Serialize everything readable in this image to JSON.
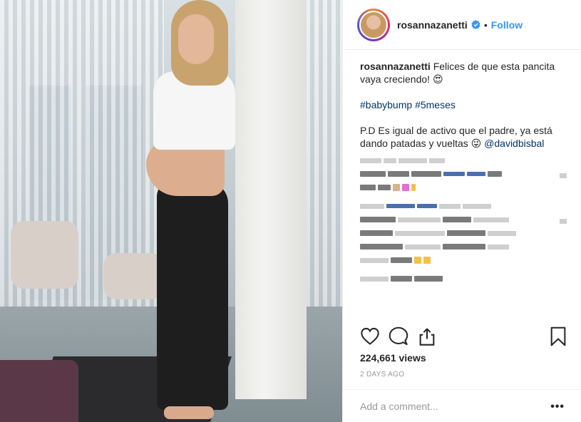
{
  "header": {
    "username": "rosannazanetti",
    "separator": "•",
    "follow_label": "Follow",
    "verified_icon": "verified-badge-icon",
    "accent": "#3897f0"
  },
  "caption": {
    "username": "rosannazanetti",
    "line1": "Felices de que esta pancita vaya creciendo! 😍",
    "hashtag1": "#babybump",
    "hashtag2": "#5meses",
    "line3": "P.D Es igual de activo que el padre, ya está dando patadas y vueltas 😜",
    "mention": "@davidbisbal"
  },
  "actions": {
    "like_icon": "heart-icon",
    "comment_icon": "comment-icon",
    "share_icon": "share-icon",
    "save_icon": "bookmark-icon"
  },
  "stats": {
    "views": "224,661 views",
    "date": "2 DAYS AGO"
  },
  "comment_box": {
    "placeholder": "Add a comment...",
    "more": "•••"
  }
}
